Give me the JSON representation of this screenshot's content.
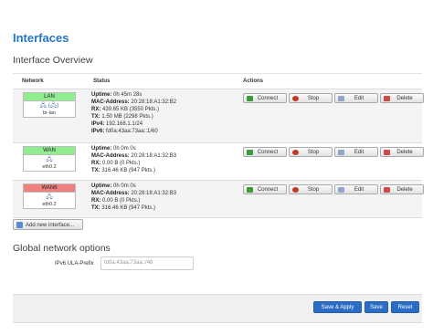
{
  "page_title": "Interfaces",
  "overview_title": "Interface Overview",
  "columns": {
    "network": "Network",
    "status": "Status",
    "actions": "Actions"
  },
  "interfaces": [
    {
      "name": "LAN",
      "name_color": "#90ee90",
      "icons": "🖧 (🖧)",
      "device": "br-lan",
      "status": [
        {
          "k": "Uptime:",
          "v": "0h 45m 28s"
        },
        {
          "k": "MAC-Address:",
          "v": "20:28:18:A1:32:B2"
        },
        {
          "k": "RX:",
          "v": "439.65 KB (3550 Pkts.)"
        },
        {
          "k": "TX:",
          "v": "1.50 MB (2298 Pkts.)"
        },
        {
          "k": "IPv4:",
          "v": "192.168.1.1/24"
        },
        {
          "k": "IPv6:",
          "v": "fd0a:43aa:73aa::1/60"
        }
      ]
    },
    {
      "name": "WAN",
      "name_color": "#90ee90",
      "icons": "🖧",
      "device": "eth0.2",
      "status": [
        {
          "k": "Uptime:",
          "v": "0h 0m 0s"
        },
        {
          "k": "MAC-Address:",
          "v": "20:28:18:A1:32:B3"
        },
        {
          "k": "RX:",
          "v": "0.00 B (0 Pkts.)"
        },
        {
          "k": "TX:",
          "v": "316.46 KB (947 Pkts.)"
        }
      ]
    },
    {
      "name": "WAN6",
      "name_color": "#f08080",
      "icons": "🖧",
      "device": "eth0.2",
      "status": [
        {
          "k": "Uptime:",
          "v": "0h 0m 0s"
        },
        {
          "k": "MAC-Address:",
          "v": "20:28:18:A1:32:B3"
        },
        {
          "k": "RX:",
          "v": "0.00 B (0 Pkts.)"
        },
        {
          "k": "TX:",
          "v": "316.46 KB (947 Pkts.)"
        }
      ]
    }
  ],
  "actions": {
    "connect": "Connect",
    "stop": "Stop",
    "edit": "Edit",
    "delete": "Delete"
  },
  "add_interface_label": "Add new interface...",
  "global_title": "Global network options",
  "ula_label": "IPv6 ULA-Prefix",
  "ula_value": "fd0a:43aa:73aa::/48",
  "footer": {
    "save_apply": "Save & Apply",
    "save": "Save",
    "reset": "Reset"
  }
}
